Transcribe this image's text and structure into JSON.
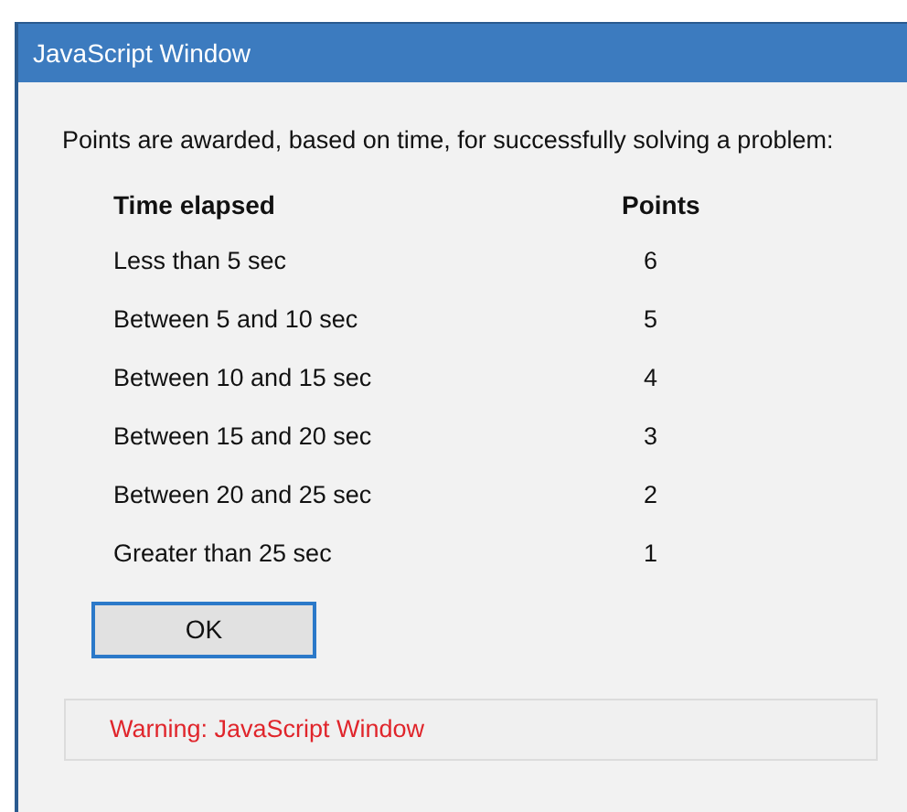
{
  "window": {
    "title": "JavaScript Window"
  },
  "intro": "Points are awarded, based on time, for successfully solving a problem:",
  "table": {
    "columns": [
      "Time elapsed",
      "Points"
    ],
    "rows": [
      [
        "Less than 5 sec",
        "6"
      ],
      [
        "Between 5 and 10 sec",
        "5"
      ],
      [
        "Between 10 and 15 sec",
        "4"
      ],
      [
        "Between 15 and 20 sec",
        "3"
      ],
      [
        "Between 20 and 25 sec",
        "2"
      ],
      [
        "Greater than 25 sec",
        "1"
      ]
    ]
  },
  "button": {
    "label": "OK"
  },
  "warning": "Warning: JavaScript Window"
}
